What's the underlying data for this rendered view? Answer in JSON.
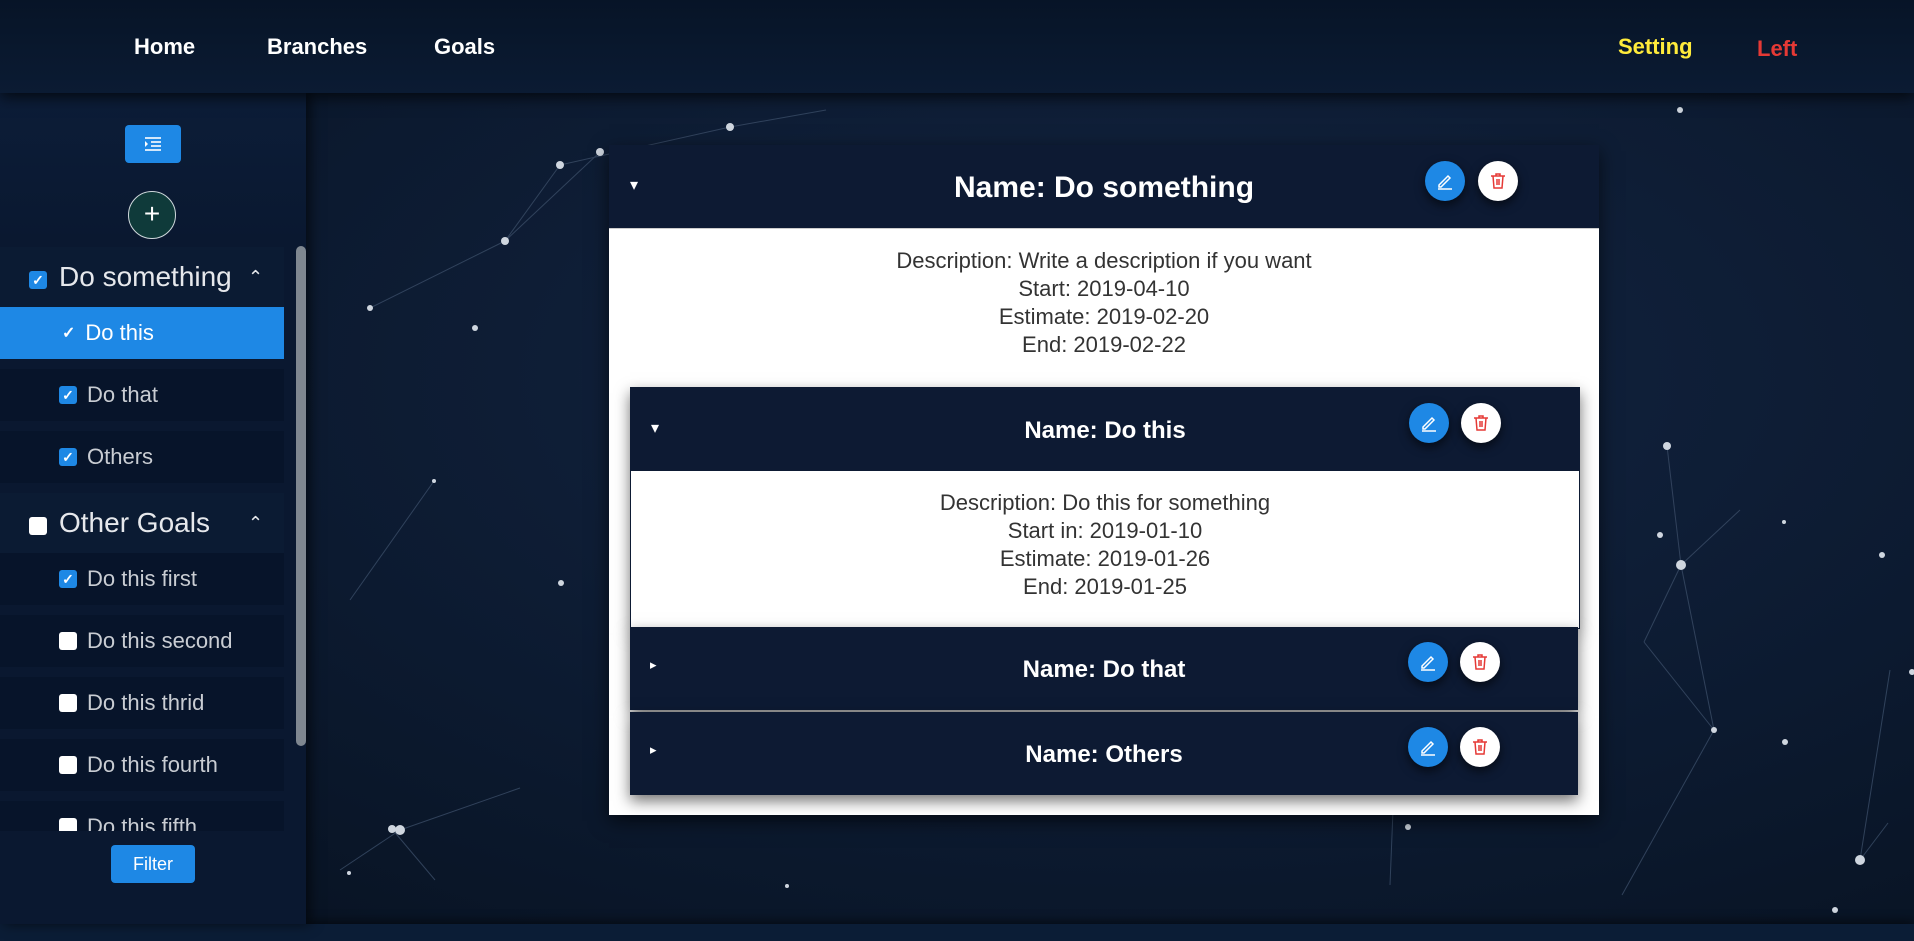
{
  "nav": {
    "home": "Home",
    "branches": "Branches",
    "goals": "Goals",
    "setting": "Setting",
    "left": "Left"
  },
  "colors": {
    "accent": "#1e88e5",
    "setting": "#ffeb3b",
    "left": "#e53935",
    "header_bg": "#0d1a33"
  },
  "sidebar": {
    "menu_icon": "list-indent-icon",
    "add_icon": "plus-icon",
    "groups": [
      {
        "title": "Do something",
        "checked": true,
        "items": [
          {
            "label": "Do this",
            "checked": true,
            "active": true
          },
          {
            "label": "Do that",
            "checked": true
          },
          {
            "label": "Others",
            "checked": true
          }
        ]
      },
      {
        "title": "Other Goals",
        "checked": false,
        "items": [
          {
            "label": "Do this first",
            "checked": true
          },
          {
            "label": "Do this second",
            "checked": false
          },
          {
            "label": "Do this thrid",
            "checked": false
          },
          {
            "label": "Do this fourth",
            "checked": false
          },
          {
            "label": "Do this fifth",
            "checked": false
          }
        ]
      }
    ],
    "filter_label": "Filter"
  },
  "goal": {
    "name": "Name: Do something",
    "description": "Description: Write a description if you want",
    "start": "Start: 2019-04-10",
    "estimate": "Estimate: 2019-02-20",
    "end": "End: 2019-02-22",
    "subtasks": [
      {
        "name": "Name: Do this",
        "expanded": true,
        "description": "Description: Do this for something",
        "start": "Start in: 2019-01-10",
        "estimate": "Estimate: 2019-01-26",
        "end": "End: 2019-01-25"
      },
      {
        "name": "Name: Do that",
        "expanded": false
      },
      {
        "name": "Name: Others",
        "expanded": false
      }
    ]
  }
}
